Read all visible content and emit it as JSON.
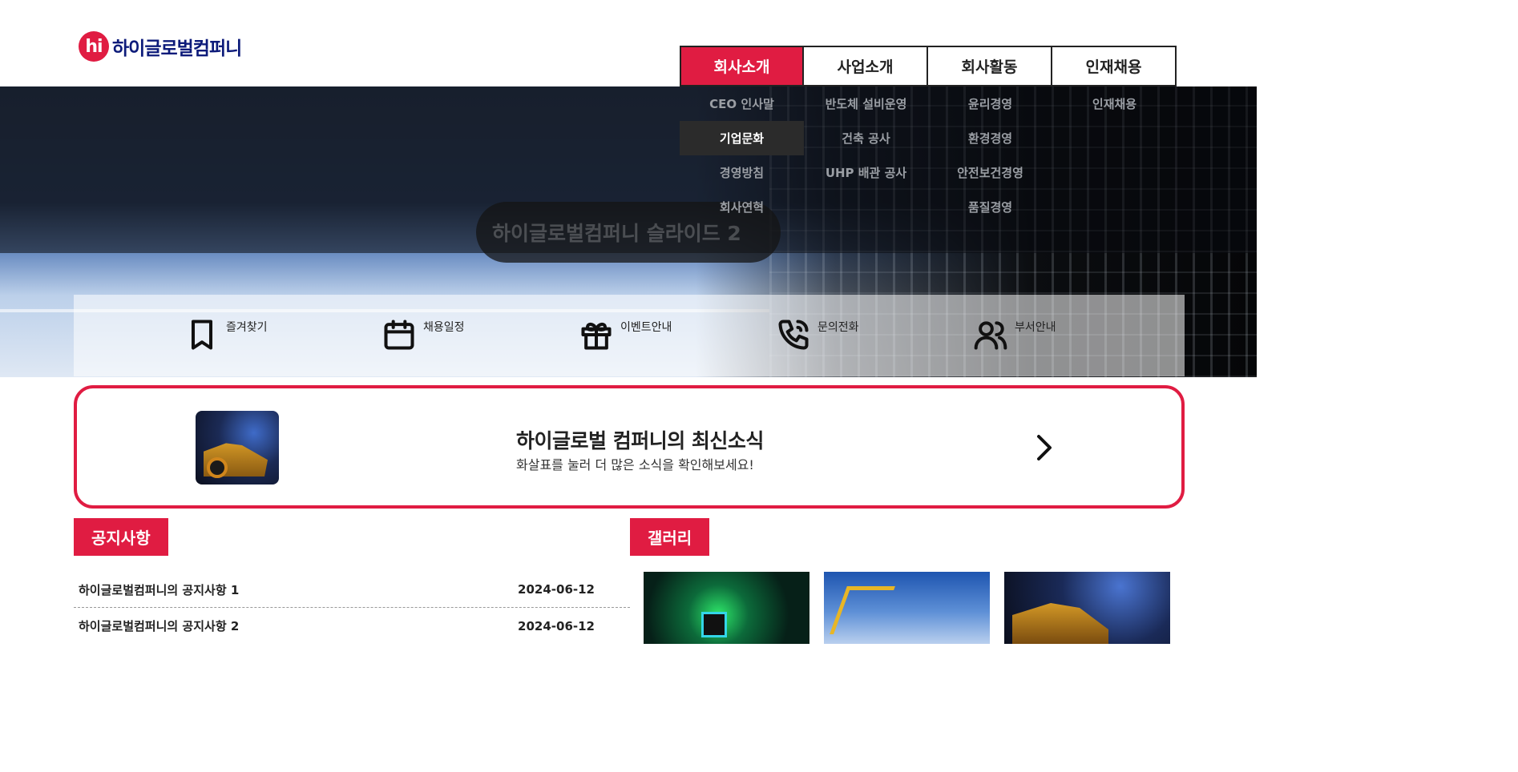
{
  "header": {
    "logo_mark": "hi",
    "logo_text": "하이글로벌컴퍼니"
  },
  "nav": {
    "items": [
      {
        "label": "회사소개",
        "active": true
      },
      {
        "label": "사업소개",
        "active": false
      },
      {
        "label": "회사활동",
        "active": false
      },
      {
        "label": "인재채용",
        "active": false
      }
    ],
    "submenu": [
      [
        "CEO 인사말",
        "기업문화",
        "경영방침",
        "회사연혁"
      ],
      [
        "반도체 설비운영",
        "건축 공사",
        "UHP 배관 공사"
      ],
      [
        "윤리경영",
        "환경경영",
        "안전보건경영",
        "품질경영"
      ],
      [
        "인재채용"
      ]
    ],
    "hovered_submenu_item": "기업문화"
  },
  "hero": {
    "slide_caption": "하이글로벌컴퍼니 슬라이드 2"
  },
  "quick_menu": [
    {
      "label": "즐겨찾기",
      "icon": "bookmark-icon"
    },
    {
      "label": "채용일정",
      "icon": "calendar-icon"
    },
    {
      "label": "이벤트안내",
      "icon": "gift-icon"
    },
    {
      "label": "문의전화",
      "icon": "phone-call-icon"
    },
    {
      "label": "부서안내",
      "icon": "users-icon"
    }
  ],
  "news_banner": {
    "title": "하이글로벌 컴퍼니의 최신소식",
    "subtitle": "화살표를 눌러 더 많은 소식을 확인해보세요!",
    "arrow_icon": "chevron-right-icon"
  },
  "notice": {
    "title": "공지사항",
    "items": [
      {
        "title": "하이글로벌컴퍼니의 공지사항 1",
        "date": "2024-06-12"
      },
      {
        "title": "하이글로벌컴퍼니의 공지사항 2",
        "date": "2024-06-12"
      }
    ]
  },
  "gallery": {
    "title": "갤러리"
  },
  "colors": {
    "brand_red": "#e01c42",
    "logo_navy": "#0d1b7a"
  }
}
